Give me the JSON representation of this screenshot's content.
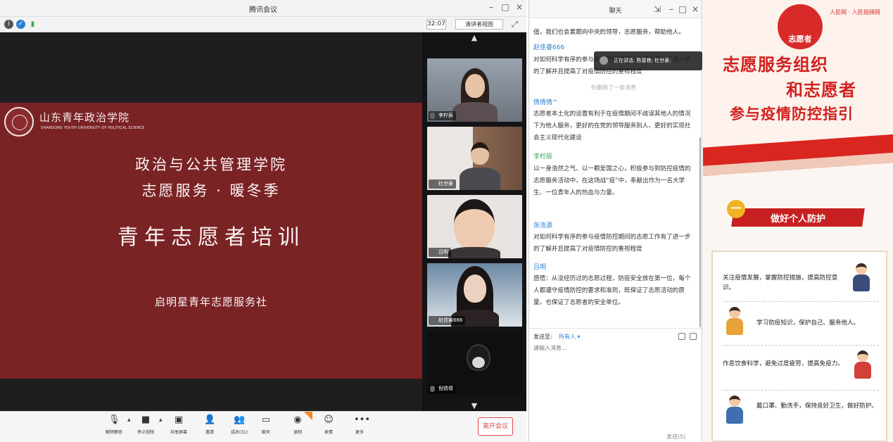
{
  "meeting": {
    "window_title": "腾讯会议",
    "timer": "32:07",
    "view_mode": "演讲者视图",
    "slide": {
      "school_name": "山东青年政治学院",
      "school_name_en": "SHANDONG YOUTH UNIVERSITY OF POLITICAL SCIENCE",
      "line1": "政治与公共管理学院",
      "line2": "志愿服务 · 暖冬季",
      "line3": "青年志愿者培训",
      "org": "启明星青年志愿服务社"
    },
    "participants": [
      {
        "name": "李柠辰"
      },
      {
        "name": "杜世豪"
      },
      {
        "name": "吕明"
      },
      {
        "name": "赵佳睿666"
      },
      {
        "name": "倪倩倩"
      }
    ],
    "toolbar": {
      "mute": "解除静音",
      "video": "停止视频",
      "share": "共享屏幕",
      "invite": "邀请",
      "members": "成员(31)",
      "chat": "聊天",
      "record": "录制",
      "reaction": "表情",
      "more": "更多",
      "leave": "离开会议"
    }
  },
  "chat": {
    "title": "聊天",
    "messages": [
      {
        "text": "值，我们也会累跟向中央的领导，志愿服务，帮助他人。"
      },
      {
        "sender": "赵佳睿666",
        "text": "对如何科学有序的参与疫情防控期间的志愿工作有了进一步的了解并且提高了对疫情防控的重视程度"
      },
      {
        "sender": "倩倩倩^",
        "text": "志愿者本土化的设置有利于在疫情期间不歧误其他人的情况下为他人服务，更好的在党的领导服务别人，更好的实现社会主义现代化建设"
      },
      {
        "sender": "李柠辰",
        "text": "以一身浩然之气、以一颗爱国之心，积极参与到防控疫情的志愿服务活动中，在这场战“疫”中，奉献出作为一名大学生、一位青年人的热血与力量。"
      },
      {
        "sender": "张浩源",
        "text": "对如何科学有序的参与疫情防控期间的志愿工作有了进一步的了解并且提高了对疫情防控的重视程度"
      },
      {
        "sender": "吕明",
        "text": "感悟：从没经历过的志愿过程，防疫安全放在第一位，每个人都遵守疫情防控的要求和准则，既保证了志愿活动的质量，也保证了志愿者的安全单位。"
      }
    ],
    "notice": "你删除了一条消息",
    "speaking": "正在讲话: 陈雷艳; 杜世豪;",
    "send_to_label": "发送至:",
    "send_to_target": "所有人 ▾",
    "input_placeholder": "请输入消息...",
    "send_label": "发送(S)"
  },
  "poster": {
    "badge": "志愿者",
    "logo": "人民网 · 人民视频网",
    "title1": "志愿服务组织",
    "title2": "和志愿者",
    "title3": "参与疫情防控指引",
    "section_num": "一",
    "section_title": "做好个人防护",
    "tips": [
      "关注疫情发展，掌握防控措施，提高防控意识。",
      "学习防疫知识，保护自己、服务他人。",
      "作息饮食科学，避免过度疲劳，提高免疫力。",
      "戴口罩、勤洗手，保持良好卫生，做好防护。"
    ]
  }
}
